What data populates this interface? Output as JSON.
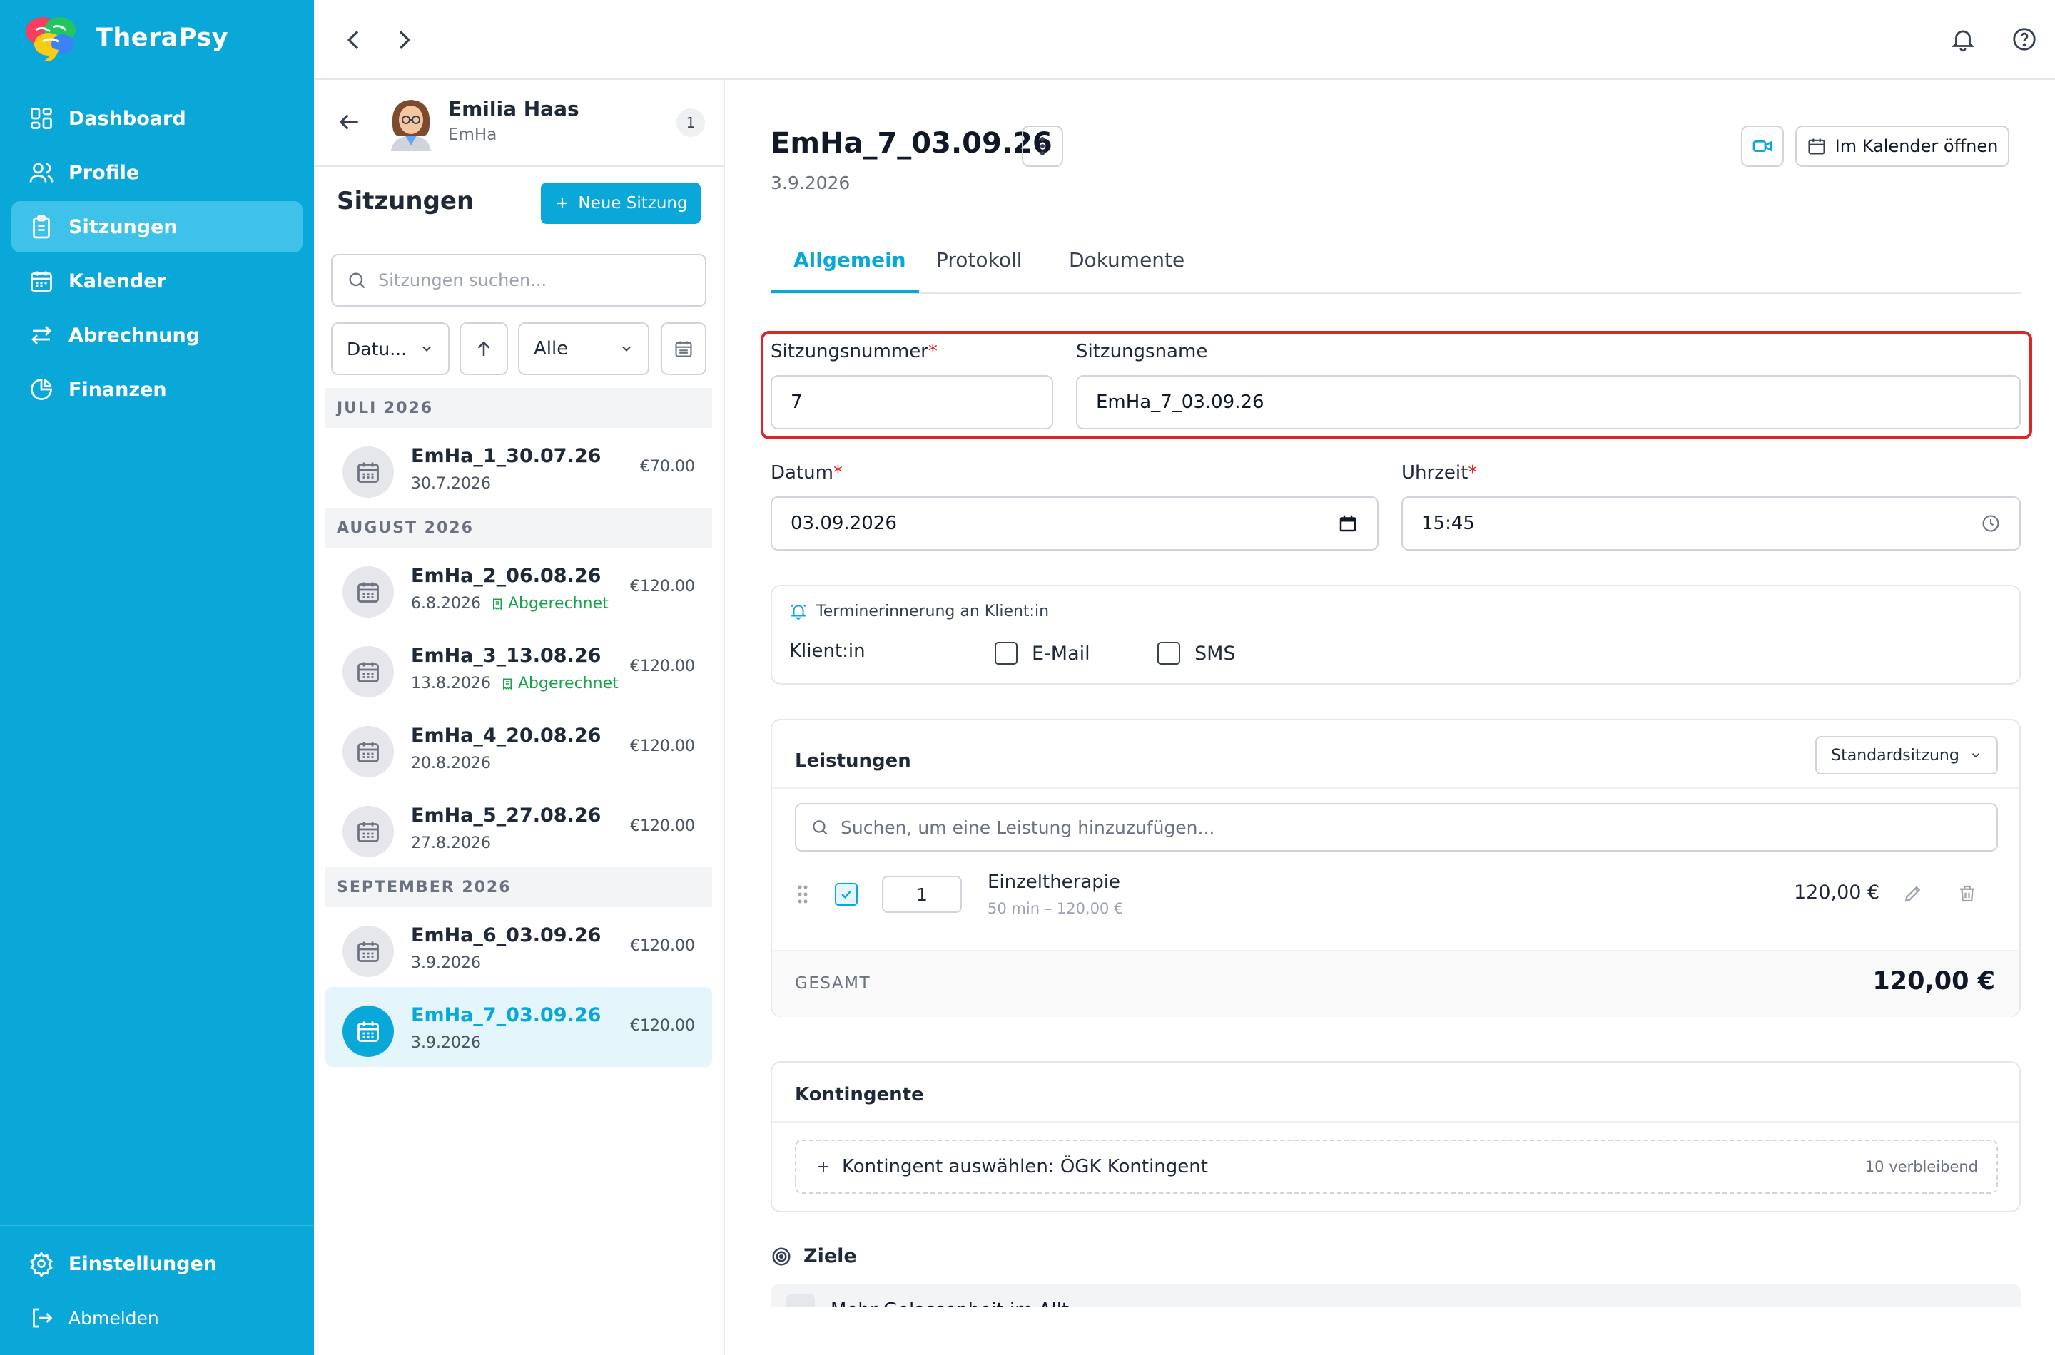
{
  "app": {
    "name": "TheraPsy",
    "logo_icon": "brain-logo-icon"
  },
  "sidebar": {
    "items": [
      {
        "label": "Dashboard",
        "icon": "dashboard-icon"
      },
      {
        "label": "Profile",
        "icon": "users-icon"
      },
      {
        "label": "Sitzungen",
        "icon": "clipboard-icon",
        "active": true
      },
      {
        "label": "Kalender",
        "icon": "calendar-icon"
      },
      {
        "label": "Abrechnung",
        "icon": "arrows-exchange-icon"
      },
      {
        "label": "Finanzen",
        "icon": "pie-chart-icon"
      }
    ],
    "settings": "Einstellungen",
    "logout": "Abmelden"
  },
  "client": {
    "name": "Emilia Haas",
    "code": "EmHa",
    "badge": "1"
  },
  "sessions_panel": {
    "title": "Sitzungen",
    "new_button": "Neue Sitzung",
    "search_placeholder": "Sitzungen suchen...",
    "sort_select": "Datu...",
    "filter_select": "Alle",
    "groups": [
      {
        "month": "JULI 2026",
        "items": [
          {
            "name": "EmHa_1_30.07.26",
            "date": "30.7.2026",
            "price": "€70.00"
          }
        ]
      },
      {
        "month": "AUGUST 2026",
        "items": [
          {
            "name": "EmHa_2_06.08.26",
            "date": "6.8.2026",
            "price": "€120.00",
            "status": "Abgerechnet"
          },
          {
            "name": "EmHa_3_13.08.26",
            "date": "13.8.2026",
            "price": "€120.00",
            "status": "Abgerechnet"
          },
          {
            "name": "EmHa_4_20.08.26",
            "date": "20.8.2026",
            "price": "€120.00"
          },
          {
            "name": "EmHa_5_27.08.26",
            "date": "27.8.2026",
            "price": "€120.00"
          }
        ]
      },
      {
        "month": "SEPTEMBER 2026",
        "items": [
          {
            "name": "EmHa_6_03.09.26",
            "date": "3.9.2026",
            "price": "€120.00"
          },
          {
            "name": "EmHa_7_03.09.26",
            "date": "3.9.2026",
            "price": "€120.00",
            "active": true
          }
        ]
      }
    ]
  },
  "detail": {
    "title": "EmHa_7_03.09.26",
    "subtitle": "3.9.2026",
    "calendar_button": "Im Kalender öffnen",
    "tabs": [
      "Allgemein",
      "Protokoll",
      "Dokumente"
    ],
    "active_tab": "Allgemein",
    "form": {
      "number_label": "Sitzungsnummer",
      "number_value": "7",
      "name_label": "Sitzungsname",
      "name_value": "EmHa_7_03.09.26",
      "date_label": "Datum",
      "date_value": "03.09.2026",
      "time_label": "Uhrzeit",
      "time_value": "15:45"
    },
    "reminder": {
      "title": "Terminerinnerung an Klient:in",
      "row_label": "Klient:in",
      "email": "E-Mail",
      "sms": "SMS"
    },
    "services": {
      "title": "Leistungen",
      "template_select": "Standardsitzung",
      "search_placeholder": "Suchen, um eine Leistung hinzuzufügen...",
      "items": [
        {
          "qty": "1",
          "name": "Einzeltherapie",
          "meta": "50 min – 120,00 €",
          "price": "120,00 €",
          "checked": true
        }
      ],
      "total_label": "GESAMT",
      "total_value": "120,00 €"
    },
    "quotas": {
      "title": "Kontingente",
      "select_text": "Kontingent auswählen: ÖGK Kontingent",
      "remaining": "10 verbleibend"
    },
    "goals": {
      "title": "Ziele",
      "partial_item": "Mehr Gelassenheit im Allt"
    }
  },
  "colors": {
    "primary": "#0aa8d8",
    "active_nav": "#3fc2ea",
    "highlight_border": "#dc2626",
    "billed": "#16a34a"
  }
}
